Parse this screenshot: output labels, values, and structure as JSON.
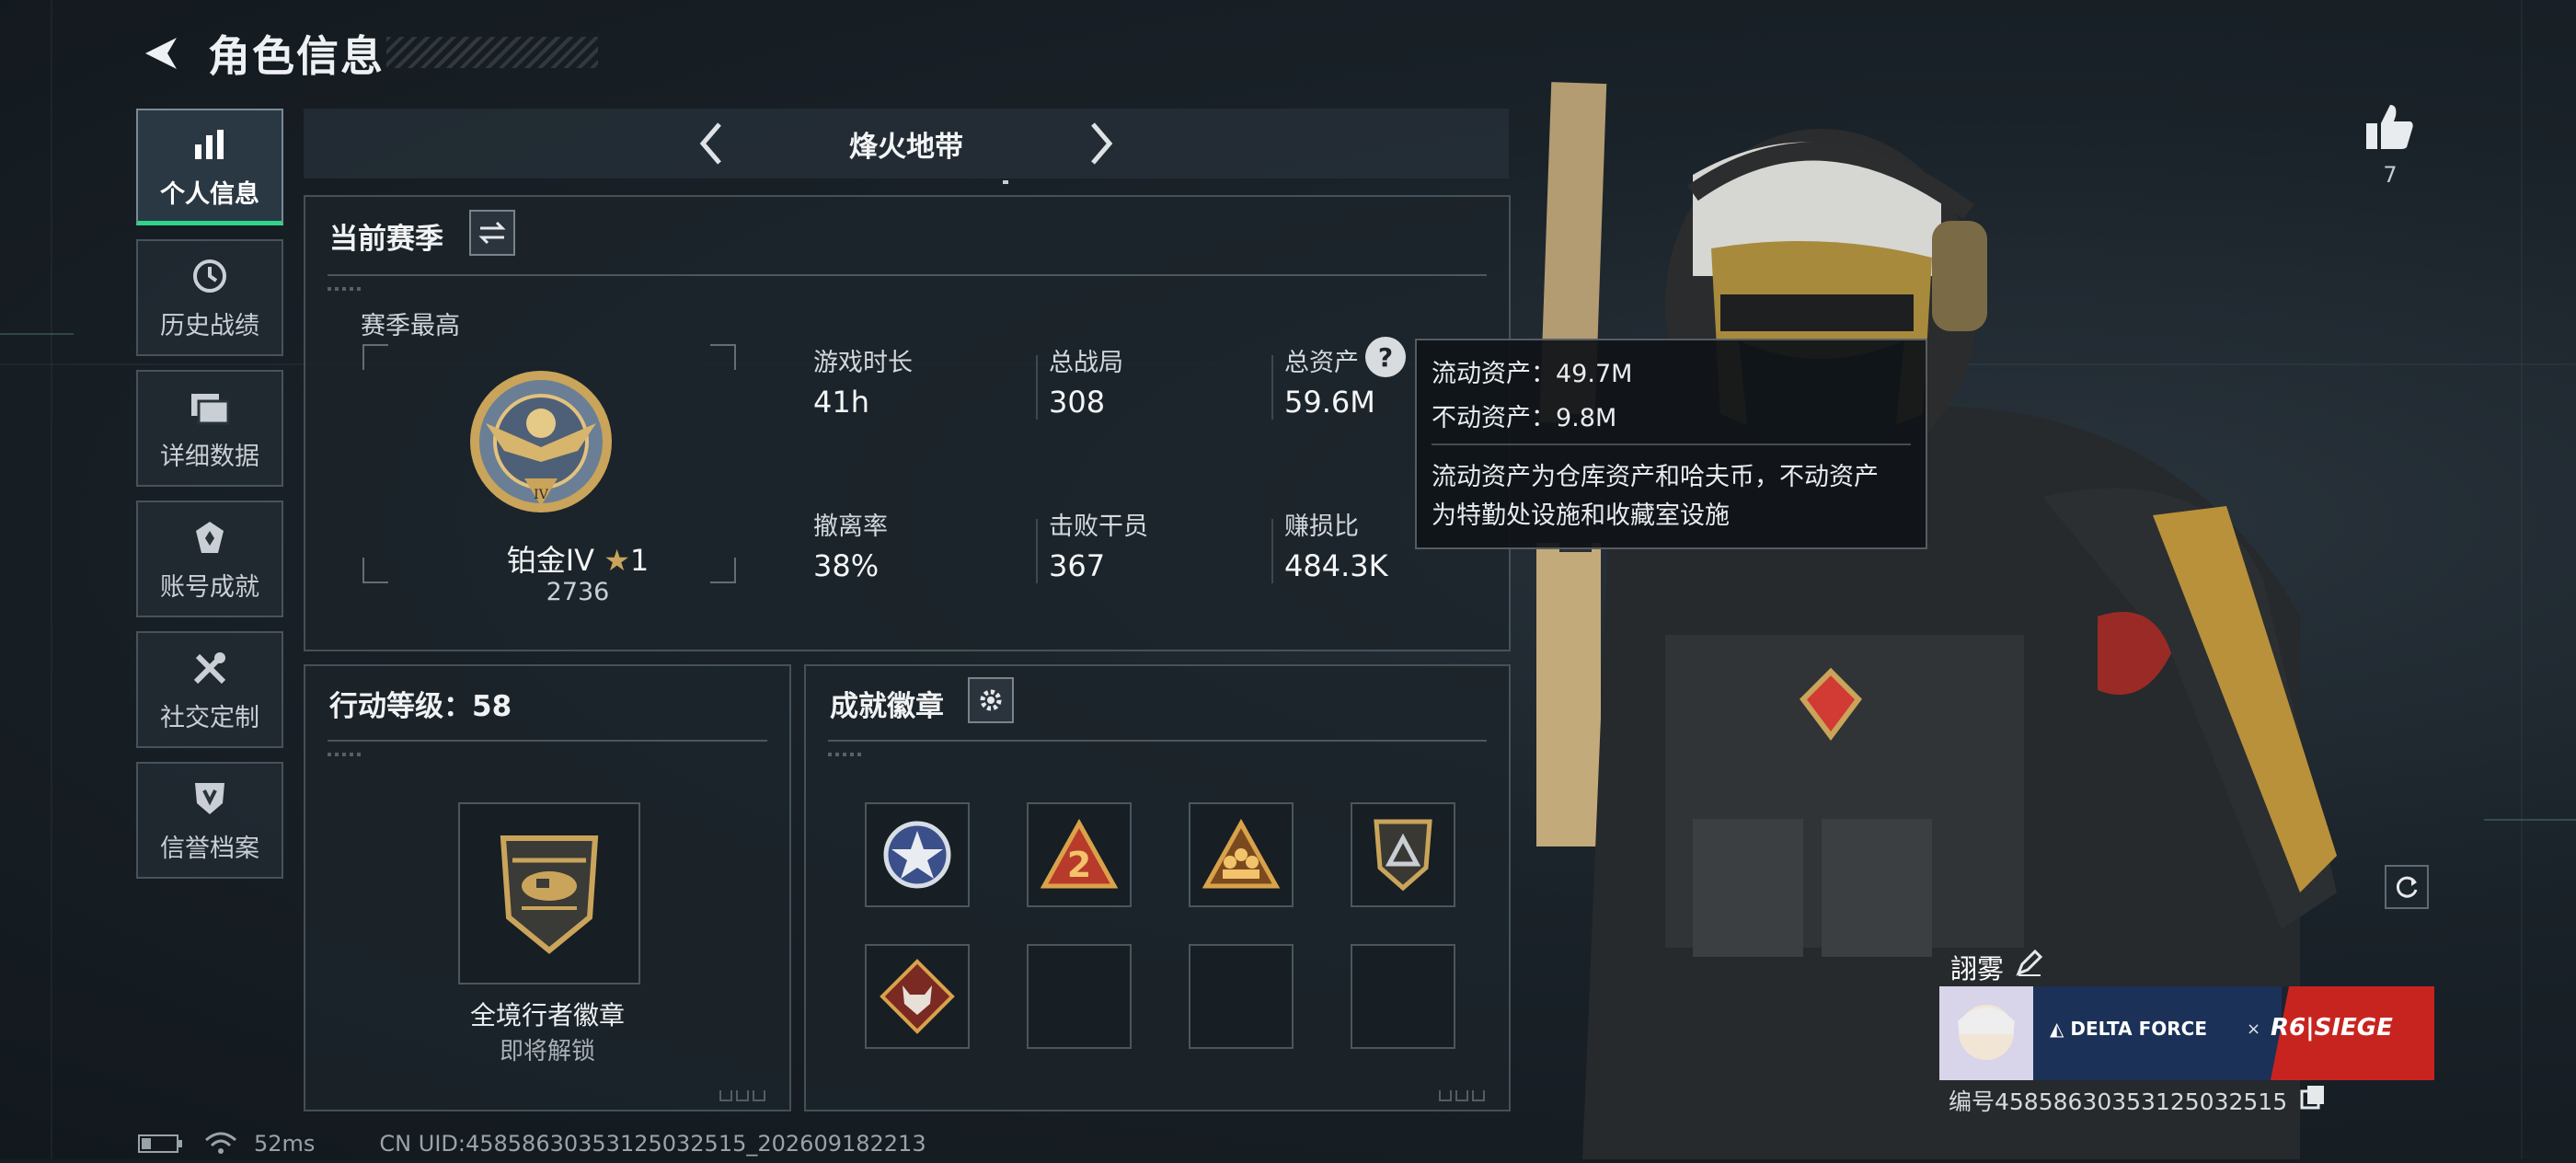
{
  "header": {
    "title": "角色信息"
  },
  "nav": {
    "items": [
      {
        "label": "个人信息",
        "icon": "bar-chart-icon",
        "active": true
      },
      {
        "label": "历史战绩",
        "icon": "history-icon",
        "active": false
      },
      {
        "label": "详细数据",
        "icon": "folders-icon",
        "active": false
      },
      {
        "label": "账号成就",
        "icon": "achievement-icon",
        "active": false
      },
      {
        "label": "社交定制",
        "icon": "tools-icon",
        "active": false
      },
      {
        "label": "信誉档案",
        "icon": "shield-icon",
        "active": false
      }
    ]
  },
  "mode": {
    "name": "烽火地带"
  },
  "season": {
    "title": "当前赛季",
    "best_label": "赛季最高",
    "rank_name": "铂金IV",
    "rank_stars": "1",
    "rank_score": "2736",
    "stats": [
      {
        "label": "游戏时长",
        "value": "41h"
      },
      {
        "label": "总战局",
        "value": "308"
      },
      {
        "label": "总资产",
        "value": "59.6M"
      },
      {
        "label": "撤离率",
        "value": "38%"
      },
      {
        "label": "击败干员",
        "value": "367"
      },
      {
        "label": "赚损比",
        "value": "484.3K"
      }
    ]
  },
  "tooltip": {
    "liquid": "流动资产：49.7M",
    "fixed": "不动资产：9.8M",
    "desc1": "流动资产为仓库资产和哈夫币，不动资产",
    "desc2": "为特勤处设施和收藏室设施"
  },
  "level": {
    "title": "行动等级：58",
    "badge_name": "全境行者徽章",
    "badge_status": "即将解锁"
  },
  "achievements": {
    "title": "成就徽章",
    "slots": [
      "star-emblem-badge",
      "number-2-badge",
      "squad-badge",
      "triangle-badge",
      "wolf-badge",
      "",
      "",
      ""
    ]
  },
  "likes": {
    "count": "7"
  },
  "player": {
    "name": "詡雾",
    "banner_text_1": "DELTA FORCE",
    "banner_x": "×",
    "banner_text_2": "R6|SIEGE",
    "uid_label": "编号4585863035312503251​5"
  },
  "status": {
    "ping": "52ms",
    "uid": "CN UID:4585863035312503251​5_202609182213"
  },
  "colors": {
    "accent_green": "#2fd48a",
    "gold": "#c9a45a",
    "red": "#d23a34"
  }
}
